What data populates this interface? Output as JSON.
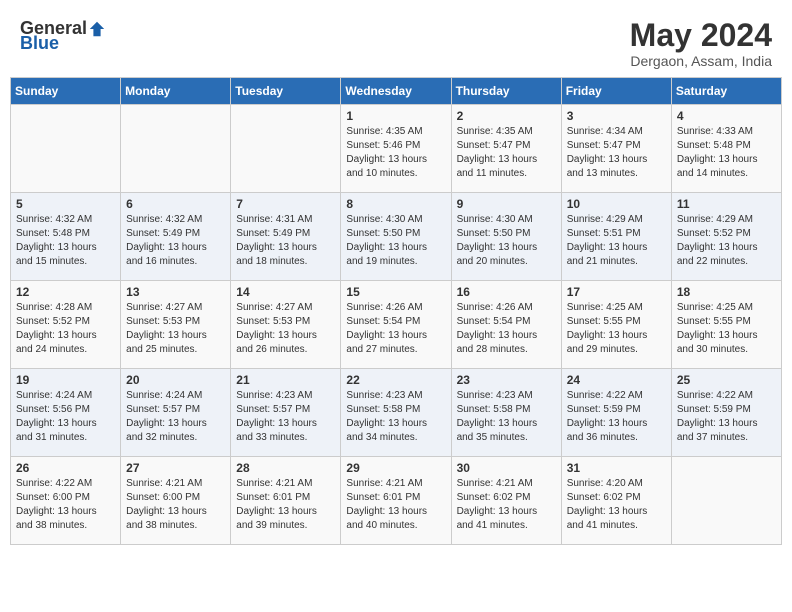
{
  "header": {
    "logo_general": "General",
    "logo_blue": "Blue",
    "month_title": "May 2024",
    "location": "Dergaon, Assam, India"
  },
  "weekdays": [
    "Sunday",
    "Monday",
    "Tuesday",
    "Wednesday",
    "Thursday",
    "Friday",
    "Saturday"
  ],
  "weeks": [
    [
      {
        "day": "",
        "content": ""
      },
      {
        "day": "",
        "content": ""
      },
      {
        "day": "",
        "content": ""
      },
      {
        "day": "1",
        "content": "Sunrise: 4:35 AM\nSunset: 5:46 PM\nDaylight: 13 hours\nand 10 minutes."
      },
      {
        "day": "2",
        "content": "Sunrise: 4:35 AM\nSunset: 5:47 PM\nDaylight: 13 hours\nand 11 minutes."
      },
      {
        "day": "3",
        "content": "Sunrise: 4:34 AM\nSunset: 5:47 PM\nDaylight: 13 hours\nand 13 minutes."
      },
      {
        "day": "4",
        "content": "Sunrise: 4:33 AM\nSunset: 5:48 PM\nDaylight: 13 hours\nand 14 minutes."
      }
    ],
    [
      {
        "day": "5",
        "content": "Sunrise: 4:32 AM\nSunset: 5:48 PM\nDaylight: 13 hours\nand 15 minutes."
      },
      {
        "day": "6",
        "content": "Sunrise: 4:32 AM\nSunset: 5:49 PM\nDaylight: 13 hours\nand 16 minutes."
      },
      {
        "day": "7",
        "content": "Sunrise: 4:31 AM\nSunset: 5:49 PM\nDaylight: 13 hours\nand 18 minutes."
      },
      {
        "day": "8",
        "content": "Sunrise: 4:30 AM\nSunset: 5:50 PM\nDaylight: 13 hours\nand 19 minutes."
      },
      {
        "day": "9",
        "content": "Sunrise: 4:30 AM\nSunset: 5:50 PM\nDaylight: 13 hours\nand 20 minutes."
      },
      {
        "day": "10",
        "content": "Sunrise: 4:29 AM\nSunset: 5:51 PM\nDaylight: 13 hours\nand 21 minutes."
      },
      {
        "day": "11",
        "content": "Sunrise: 4:29 AM\nSunset: 5:52 PM\nDaylight: 13 hours\nand 22 minutes."
      }
    ],
    [
      {
        "day": "12",
        "content": "Sunrise: 4:28 AM\nSunset: 5:52 PM\nDaylight: 13 hours\nand 24 minutes."
      },
      {
        "day": "13",
        "content": "Sunrise: 4:27 AM\nSunset: 5:53 PM\nDaylight: 13 hours\nand 25 minutes."
      },
      {
        "day": "14",
        "content": "Sunrise: 4:27 AM\nSunset: 5:53 PM\nDaylight: 13 hours\nand 26 minutes."
      },
      {
        "day": "15",
        "content": "Sunrise: 4:26 AM\nSunset: 5:54 PM\nDaylight: 13 hours\nand 27 minutes."
      },
      {
        "day": "16",
        "content": "Sunrise: 4:26 AM\nSunset: 5:54 PM\nDaylight: 13 hours\nand 28 minutes."
      },
      {
        "day": "17",
        "content": "Sunrise: 4:25 AM\nSunset: 5:55 PM\nDaylight: 13 hours\nand 29 minutes."
      },
      {
        "day": "18",
        "content": "Sunrise: 4:25 AM\nSunset: 5:55 PM\nDaylight: 13 hours\nand 30 minutes."
      }
    ],
    [
      {
        "day": "19",
        "content": "Sunrise: 4:24 AM\nSunset: 5:56 PM\nDaylight: 13 hours\nand 31 minutes."
      },
      {
        "day": "20",
        "content": "Sunrise: 4:24 AM\nSunset: 5:57 PM\nDaylight: 13 hours\nand 32 minutes."
      },
      {
        "day": "21",
        "content": "Sunrise: 4:23 AM\nSunset: 5:57 PM\nDaylight: 13 hours\nand 33 minutes."
      },
      {
        "day": "22",
        "content": "Sunrise: 4:23 AM\nSunset: 5:58 PM\nDaylight: 13 hours\nand 34 minutes."
      },
      {
        "day": "23",
        "content": "Sunrise: 4:23 AM\nSunset: 5:58 PM\nDaylight: 13 hours\nand 35 minutes."
      },
      {
        "day": "24",
        "content": "Sunrise: 4:22 AM\nSunset: 5:59 PM\nDaylight: 13 hours\nand 36 minutes."
      },
      {
        "day": "25",
        "content": "Sunrise: 4:22 AM\nSunset: 5:59 PM\nDaylight: 13 hours\nand 37 minutes."
      }
    ],
    [
      {
        "day": "26",
        "content": "Sunrise: 4:22 AM\nSunset: 6:00 PM\nDaylight: 13 hours\nand 38 minutes."
      },
      {
        "day": "27",
        "content": "Sunrise: 4:21 AM\nSunset: 6:00 PM\nDaylight: 13 hours\nand 38 minutes."
      },
      {
        "day": "28",
        "content": "Sunrise: 4:21 AM\nSunset: 6:01 PM\nDaylight: 13 hours\nand 39 minutes."
      },
      {
        "day": "29",
        "content": "Sunrise: 4:21 AM\nSunset: 6:01 PM\nDaylight: 13 hours\nand 40 minutes."
      },
      {
        "day": "30",
        "content": "Sunrise: 4:21 AM\nSunset: 6:02 PM\nDaylight: 13 hours\nand 41 minutes."
      },
      {
        "day": "31",
        "content": "Sunrise: 4:20 AM\nSunset: 6:02 PM\nDaylight: 13 hours\nand 41 minutes."
      },
      {
        "day": "",
        "content": ""
      }
    ]
  ]
}
